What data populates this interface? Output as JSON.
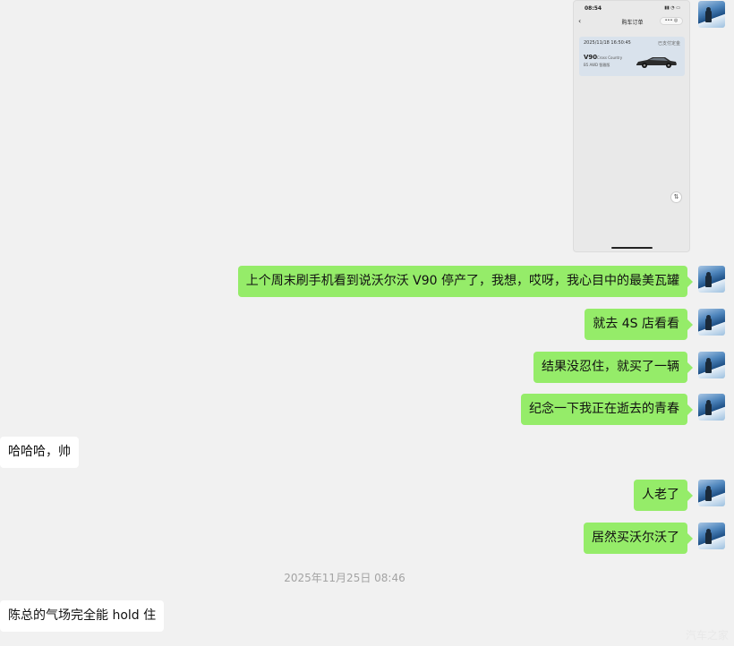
{
  "phone_screenshot": {
    "status_time": "08:54",
    "status_icons": "▮▮ ◔ ▭",
    "back_glyph": "‹",
    "title": "购车订单",
    "capsule": "••• ◎",
    "order_date": "2025/11/18 16:50:45",
    "order_status": "已支付定金",
    "car_model": "V90",
    "car_model_sub": "Cross Country",
    "car_trim": "B5 AWD 智雅版",
    "float_icon": "⇅"
  },
  "messages": [
    {
      "sender": "me",
      "text": "上个周末刷手机看到说沃尔沃 V90 停产了，我想，哎呀，我心目中的最美瓦罐"
    },
    {
      "sender": "me",
      "text": "就去 4S 店看看"
    },
    {
      "sender": "me",
      "text": "结果没忍住，就买了一辆"
    },
    {
      "sender": "me",
      "text": "纪念一下我正在逝去的青春"
    },
    {
      "sender": "other",
      "text": "哈哈哈，帅"
    },
    {
      "sender": "me",
      "text": "人老了"
    },
    {
      "sender": "me",
      "text": "居然买沃尔沃了"
    },
    {
      "sender": "other",
      "text": "陈总的气场完全能 hold 住"
    }
  ],
  "timestamp": "2025年11月25日 08:46",
  "watermark": "汽车之家",
  "colors": {
    "my_bubble": "#95ec69",
    "other_bubble": "#ffffff",
    "background": "#f1f1f1"
  }
}
